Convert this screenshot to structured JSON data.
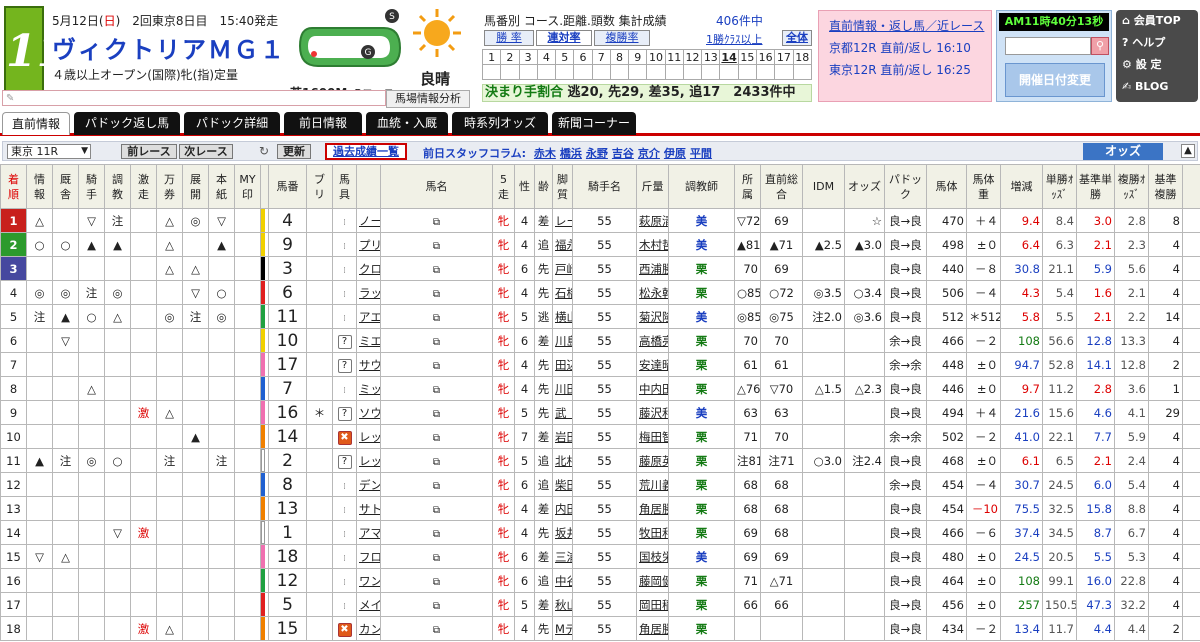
{
  "header": {
    "race_number": "11",
    "date_prefix": "5月12日(",
    "date_day": "日",
    "date_suffix": ")　2回東京8日目　15:40発走",
    "race_name": "ヴィクトリアＭＧ１",
    "race_conditions": "４歳以上オープン(国際)牝(指)定量",
    "course_surface": "芝1600M",
    "course_variant": "Bコース",
    "course_start_mark": "S",
    "course_goal_mark": "G",
    "weather": "良晴",
    "stats_title": "馬番別 コース.距離.頭数 集計成績",
    "stats_count": "406件中",
    "stats_tabs": [
      "勝 率",
      "連対率",
      "複勝率"
    ],
    "stats_link_1": "1勝ｸﾗｽ以上",
    "stats_link_2": "全体",
    "grid_row1": [
      "1",
      "2",
      "3",
      "4",
      "5",
      "6",
      "7",
      "8",
      "9",
      "10",
      "11",
      "12",
      "13",
      "14",
      "15",
      "16",
      "17",
      "18"
    ],
    "grid_row2": [
      "",
      "",
      "",
      "",
      "",
      "",
      "",
      "",
      "",
      "",
      "",
      "",
      "",
      "",
      "",
      "",
      "",
      ""
    ],
    "kimarite_label": "決まり手割合",
    "kimarite_text": "逃20, 先29, 差35, 追17　2433件中",
    "pink_box": {
      "line1": "直前情報・返し馬／近レース",
      "line2": "京都12R 直前/返し 16:10",
      "line3": "東京12R 直前/返し 16:25"
    },
    "clock_ampm": "AM",
    "clock_time": "11時40分13秒",
    "date_change_label": "開催日付変更",
    "side_menu": [
      "会員TOP",
      "? ヘルプ",
      "設 定",
      "BLOG"
    ],
    "paddock_info_label": "馬場情報分析"
  },
  "nav_tabs": [
    "直前情報",
    "パドック返し馬",
    "パドック詳細",
    "前日情報",
    "血統・入厩",
    "時系列オッズ",
    "新聞コーナー"
  ],
  "toolbar": {
    "race_select": "東京 11R",
    "prev_race": "前レース",
    "next_race": "次レース",
    "refresh": "更新",
    "past_results": "過去成績一覧",
    "staff_label": "前日スタッフコラム:",
    "staff": [
      "赤木",
      "橋浜",
      "永野",
      "吉谷",
      "京介",
      "伊原",
      "平間"
    ],
    "odds_label": "オッズ"
  },
  "columns": [
    "着順",
    "情報",
    "厩舎",
    "騎手",
    "調教",
    "激走",
    "万券",
    "展開",
    "本紙",
    "MY印",
    "",
    "馬番",
    "ブリ",
    "馬具",
    "",
    "馬名",
    "5走",
    "性",
    "齢",
    "脚質",
    "騎手名",
    "斤量",
    "調教師",
    "所属",
    "直前総合",
    "IDM",
    "オッズ",
    "パドック",
    "馬体",
    "馬体重",
    "増減",
    "単勝ｵｯｽﾞ",
    "基準単勝",
    "複勝ｵｯｽﾞ",
    "基準複勝",
    "",
    ""
  ],
  "rank_colors": [
    "#c8201c",
    "#2c9a2c",
    "#46489f"
  ],
  "waku_colors": {
    "1": "#ffffff",
    "2": "#000000",
    "3": "#e02020",
    "4": "#2060d0",
    "5": "#f0d000",
    "6": "#20a040",
    "7": "#f08000",
    "8": "#f070b0"
  },
  "horses": [
    {
      "rank": "1",
      "info": "△",
      "stable": "",
      "jockey": "▽",
      "train": "注",
      "gekiso": "",
      "manken": "△",
      "tenkai": "◎",
      "honshi": "▽",
      "my": "",
      "waku": "5",
      "no": "4",
      "bli": "",
      "gu": "",
      "hn": "ノームコア",
      "sex": "牝",
      "age": "4",
      "style": "差",
      "jockey_name": "レーン[替]",
      "kin": "55",
      "trainer": "萩原清",
      "aff": "美",
      "sog": "▽72",
      "idm": "69",
      "odds_m": "",
      "pad": "☆",
      "taii": "良→良",
      "bw": "470",
      "diff": "＋４",
      "win": "9.4",
      "bwin": "8.4",
      "place": "3.0",
      "bplace": "2.8",
      "x": "8"
    },
    {
      "rank": "2",
      "info": "○",
      "stable": "○",
      "jockey": "▲",
      "train": "▲",
      "gekiso": "",
      "manken": "△",
      "tenkai": "",
      "honshi": "▲",
      "my": "",
      "waku": "5",
      "no": "9",
      "bli": "",
      "gu": "",
      "hn": "プリモシーン",
      "sex": "牝",
      "age": "4",
      "style": "追",
      "jockey_name": "福永祐",
      "kin": "55",
      "trainer": "木村哲",
      "aff": "美",
      "sog": "▲81",
      "idm": "▲71",
      "odds_m": "▲2.5",
      "pad": "▲3.0",
      "taii": "良→良",
      "bw": "498",
      "diff": "±０",
      "win": "6.4",
      "bwin": "6.3",
      "place": "2.1",
      "bplace": "2.3",
      "x": "4"
    },
    {
      "rank": "3",
      "info": "",
      "stable": "",
      "jockey": "",
      "train": "",
      "gekiso": "",
      "manken": "△",
      "tenkai": "△",
      "honshi": "",
      "my": "",
      "waku": "2",
      "no": "3",
      "bli": "",
      "gu": "",
      "hn": "クロコスミア",
      "sex": "牝",
      "age": "6",
      "style": "先",
      "jockey_name": "戸崎圭[替]",
      "kin": "55",
      "trainer": "西浦勝",
      "aff": "栗",
      "sog": "70",
      "idm": "69",
      "odds_m": "",
      "pad": "",
      "taii": "良→良",
      "bw": "440",
      "diff": "－８",
      "win": "30.8",
      "bwin": "21.1",
      "place": "5.9",
      "bplace": "5.6",
      "x": "4"
    },
    {
      "rank": "4",
      "info": "◎",
      "stable": "◎",
      "jockey": "注",
      "train": "◎",
      "gekiso": "",
      "manken": "",
      "tenkai": "▽",
      "honshi": "○",
      "my": "",
      "waku": "3",
      "no": "6",
      "bli": "",
      "gu": "",
      "hn": "ラッキーライラック",
      "sex": "牝",
      "age": "4",
      "style": "先",
      "jockey_name": "石橋脩",
      "kin": "55",
      "trainer": "松永幹",
      "aff": "栗",
      "sog": "○85",
      "idm": "○72",
      "odds_m": "◎3.5",
      "pad": "○3.4",
      "taii": "良→良",
      "bw": "506",
      "diff": "－４",
      "win": "4.3",
      "bwin": "5.4",
      "place": "1.6",
      "bplace": "2.1",
      "x": "4"
    },
    {
      "rank": "5",
      "info": "注",
      "stable": "▲",
      "jockey": "○",
      "train": "△",
      "gekiso": "",
      "manken": "◎",
      "tenkai": "注",
      "honshi": "◎",
      "my": "",
      "waku": "6",
      "no": "11",
      "bli": "",
      "gu": "",
      "hn": "アエロリット",
      "sex": "牝",
      "age": "5",
      "style": "逃",
      "jockey_name": "横山典[替]",
      "kin": "55",
      "trainer": "菊沢隆",
      "aff": "美",
      "sog": "◎85",
      "idm": "◎75",
      "odds_m": "注2.0",
      "pad": "◎3.6",
      "taii": "良→良",
      "bw": "512",
      "diff": "＊512",
      "win": "5.8",
      "bwin": "5.5",
      "place": "2.1",
      "bplace": "2.2",
      "x": "14"
    },
    {
      "rank": "6",
      "info": "",
      "stable": "▽",
      "jockey": "",
      "train": "",
      "gekiso": "",
      "manken": "",
      "tenkai": "",
      "honshi": "",
      "my": "",
      "waku": "5",
      "no": "10",
      "bli": "",
      "gu": "?",
      "hn": "ミエノサクシード",
      "sex": "牝",
      "age": "6",
      "style": "差",
      "jockey_name": "川島信",
      "kin": "55",
      "trainer": "高橋亮",
      "aff": "栗",
      "sog": "70",
      "idm": "70",
      "odds_m": "",
      "pad": "",
      "taii": "余→良",
      "bw": "466",
      "diff": "－２",
      "win": "108",
      "bwin": "56.6",
      "place": "12.8",
      "bplace": "13.3",
      "x": "4"
    },
    {
      "rank": "7",
      "info": "",
      "stable": "",
      "jockey": "",
      "train": "",
      "gekiso": "",
      "manken": "",
      "tenkai": "",
      "honshi": "",
      "my": "",
      "waku": "8",
      "no": "17",
      "bli": "",
      "gu": "?",
      "hn": "サウンドキアラ",
      "sex": "牝",
      "age": "4",
      "style": "先",
      "jockey_name": "田辺裕[替]",
      "kin": "55",
      "trainer": "安達昭",
      "aff": "栗",
      "sog": "61",
      "idm": "61",
      "odds_m": "",
      "pad": "",
      "taii": "余→余",
      "bw": "448",
      "diff": "±０",
      "win": "94.7",
      "bwin": "52.8",
      "place": "14.1",
      "bplace": "12.8",
      "x": "2"
    },
    {
      "rank": "8",
      "info": "",
      "stable": "",
      "jockey": "△",
      "train": "",
      "gekiso": "",
      "manken": "",
      "tenkai": "",
      "honshi": "",
      "my": "",
      "waku": "4",
      "no": "7",
      "bli": "",
      "gu": "",
      "hn": "ミッキーチャーム",
      "sex": "牝",
      "age": "4",
      "style": "先",
      "jockey_name": "川田将",
      "kin": "55",
      "trainer": "中内田",
      "aff": "栗",
      "sog": "△76",
      "idm": "▽70",
      "odds_m": "△1.5",
      "pad": "△2.3",
      "taii": "良→良",
      "bw": "446",
      "diff": "±０",
      "win": "9.7",
      "bwin": "11.2",
      "place": "2.8",
      "bplace": "3.6",
      "x": "1"
    },
    {
      "rank": "9",
      "info": "",
      "stable": "",
      "jockey": "",
      "train": "",
      "gekiso": "激",
      "manken": "△",
      "tenkai": "",
      "honshi": "",
      "my": "",
      "waku": "8",
      "no": "16",
      "bli": "＊",
      "gu": "?",
      "hn": "ソウルスターリング",
      "sex": "牝",
      "age": "5",
      "style": "先",
      "jockey_name": "武　豊[替]",
      "kin": "55",
      "trainer": "藤沢和",
      "aff": "美",
      "sog": "63",
      "idm": "63",
      "odds_m": "",
      "pad": "",
      "taii": "良→良",
      "bw": "494",
      "diff": "＋４",
      "win": "21.6",
      "bwin": "15.6",
      "place": "4.6",
      "bplace": "4.1",
      "x": "29"
    },
    {
      "rank": "10",
      "info": "",
      "stable": "",
      "jockey": "",
      "train": "",
      "gekiso": "",
      "manken": "",
      "tenkai": "▲",
      "honshi": "",
      "my": "",
      "waku": "7",
      "no": "14",
      "bli": "",
      "gu": "x",
      "hn": "レッツゴードンキ",
      "sex": "牝",
      "age": "7",
      "style": "差",
      "jockey_name": "岩田康",
      "kin": "55",
      "trainer": "梅田智",
      "aff": "栗",
      "sog": "71",
      "idm": "70",
      "odds_m": "",
      "pad": "",
      "taii": "余→余",
      "bw": "502",
      "diff": "－２",
      "win": "41.0",
      "bwin": "22.1",
      "place": "7.7",
      "bplace": "5.9",
      "x": "4"
    },
    {
      "rank": "11",
      "info": "▲",
      "stable": "注",
      "jockey": "◎",
      "train": "○",
      "gekiso": "",
      "manken": "注",
      "tenkai": "",
      "honshi": "注",
      "my": "",
      "waku": "1",
      "no": "2",
      "bli": "",
      "gu": "?",
      "hn": "レッドオルガ",
      "sex": "牝",
      "age": "5",
      "style": "追",
      "jockey_name": "北村友",
      "kin": "55",
      "trainer": "藤原英",
      "aff": "栗",
      "sog": "注81",
      "idm": "注71",
      "odds_m": "○3.0",
      "pad": "注2.4",
      "taii": "良→良",
      "bw": "468",
      "diff": "±０",
      "win": "6.1",
      "bwin": "6.5",
      "place": "2.1",
      "bplace": "2.4",
      "x": "4"
    },
    {
      "rank": "12",
      "info": "",
      "stable": "",
      "jockey": "",
      "train": "",
      "gekiso": "",
      "manken": "",
      "tenkai": "",
      "honshi": "",
      "my": "",
      "waku": "4",
      "no": "8",
      "bli": "",
      "gu": "",
      "hn": "デンコウアンジュ",
      "sex": "牝",
      "age": "6",
      "style": "追",
      "jockey_name": "柴田善",
      "kin": "55",
      "trainer": "荒川義",
      "aff": "栗",
      "sog": "68",
      "idm": "68",
      "odds_m": "",
      "pad": "",
      "taii": "余→良",
      "bw": "454",
      "diff": "－４",
      "win": "30.7",
      "bwin": "24.5",
      "place": "6.0",
      "bplace": "5.4",
      "x": "4"
    },
    {
      "rank": "13",
      "info": "",
      "stable": "",
      "jockey": "",
      "train": "",
      "gekiso": "",
      "manken": "",
      "tenkai": "",
      "honshi": "",
      "my": "",
      "waku": "7",
      "no": "13",
      "bli": "",
      "gu": "",
      "hn": "サトノワルキューレ",
      "sex": "牝",
      "age": "4",
      "style": "差",
      "jockey_name": "内田博[替]",
      "kin": "55",
      "trainer": "角居勝",
      "aff": "栗",
      "sog": "68",
      "idm": "68",
      "odds_m": "",
      "pad": "",
      "taii": "良→良",
      "bw": "454",
      "diff": "－10",
      "win": "75.5",
      "bwin": "32.5",
      "place": "15.8",
      "bplace": "8.8",
      "x": "4"
    },
    {
      "rank": "14",
      "info": "",
      "stable": "",
      "jockey": "",
      "train": "▽",
      "gekiso": "激",
      "manken": "",
      "tenkai": "",
      "honshi": "",
      "my": "",
      "waku": "1",
      "no": "1",
      "bli": "",
      "gu": "",
      "hn": "アマルフィコースト",
      "sex": "牝",
      "age": "4",
      "style": "先",
      "jockey_name": "坂井瑠",
      "kin": "55",
      "trainer": "牧田和",
      "aff": "栗",
      "sog": "69",
      "idm": "68",
      "odds_m": "",
      "pad": "",
      "taii": "良→良",
      "bw": "466",
      "diff": "－６",
      "win": "37.4",
      "bwin": "34.5",
      "place": "8.7",
      "bplace": "6.7",
      "x": "4"
    },
    {
      "rank": "15",
      "info": "▽",
      "stable": "△",
      "jockey": "",
      "train": "",
      "gekiso": "",
      "manken": "",
      "tenkai": "",
      "honshi": "",
      "my": "",
      "waku": "8",
      "no": "18",
      "bli": "",
      "gu": "",
      "hn": "フロンテアクイーン",
      "sex": "牝",
      "age": "6",
      "style": "差",
      "jockey_name": "三浦皇",
      "kin": "55",
      "trainer": "国枝栄",
      "aff": "美",
      "sog": "69",
      "idm": "69",
      "odds_m": "",
      "pad": "",
      "taii": "良→良",
      "bw": "480",
      "diff": "±０",
      "win": "24.5",
      "bwin": "20.5",
      "place": "5.5",
      "bplace": "5.3",
      "x": "4"
    },
    {
      "rank": "16",
      "info": "",
      "stable": "",
      "jockey": "",
      "train": "",
      "gekiso": "",
      "manken": "",
      "tenkai": "",
      "honshi": "",
      "my": "",
      "waku": "6",
      "no": "12",
      "bli": "",
      "gu": "",
      "hn": "ワントゥワン",
      "sex": "牝",
      "age": "6",
      "style": "追",
      "jockey_name": "中谷雄[替]",
      "kin": "55",
      "trainer": "藤岡健",
      "aff": "栗",
      "sog": "71",
      "idm": "△71",
      "odds_m": "",
      "pad": "",
      "taii": "良→良",
      "bw": "464",
      "diff": "±０",
      "win": "108",
      "bwin": "99.1",
      "place": "16.0",
      "bplace": "22.8",
      "x": "4"
    },
    {
      "rank": "17",
      "info": "",
      "stable": "",
      "jockey": "",
      "train": "",
      "gekiso": "",
      "manken": "",
      "tenkai": "",
      "honshi": "",
      "my": "",
      "waku": "3",
      "no": "5",
      "bli": "",
      "gu": "",
      "hn": "メイショウオワラ",
      "sex": "牝",
      "age": "5",
      "style": "差",
      "jockey_name": "秋山真[替]",
      "kin": "55",
      "trainer": "岡田稲",
      "aff": "栗",
      "sog": "66",
      "idm": "66",
      "odds_m": "",
      "pad": "",
      "taii": "良→良",
      "bw": "456",
      "diff": "±０",
      "win": "257",
      "bwin": "150.5",
      "place": "47.3",
      "bplace": "32.2",
      "x": "4"
    },
    {
      "rank": "18",
      "info": "",
      "stable": "",
      "jockey": "",
      "train": "",
      "gekiso": "激",
      "manken": "△",
      "tenkai": "",
      "honshi": "",
      "my": "",
      "waku": "7",
      "no": "15",
      "bli": "",
      "gu": "x",
      "hn": "カンタービレ",
      "sex": "牝",
      "age": "4",
      "style": "先",
      "jockey_name": "Mデム",
      "kin": "55",
      "trainer": "角居勝",
      "aff": "栗",
      "sog": "",
      "idm": "",
      "odds_m": "",
      "pad": "",
      "taii": "良→良",
      "bw": "434",
      "diff": "－２",
      "win": "13.4",
      "bwin": "11.7",
      "place": "4.4",
      "bplace": "4.4",
      "x": "2"
    }
  ]
}
